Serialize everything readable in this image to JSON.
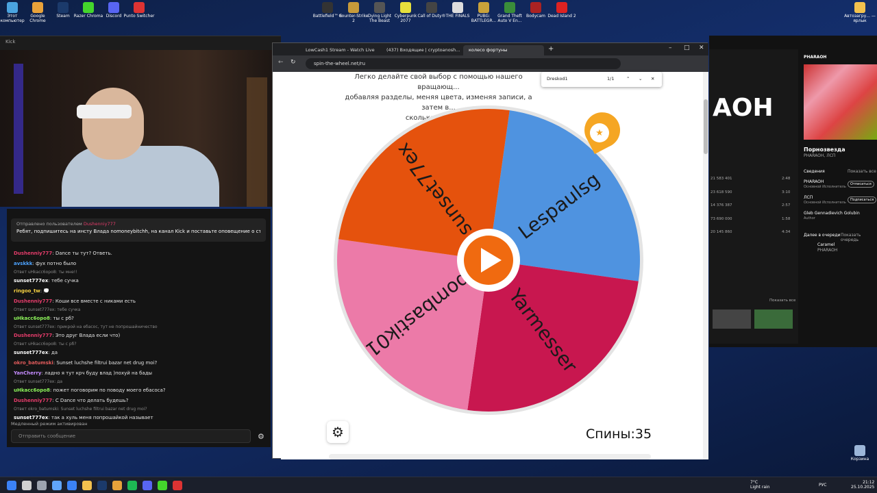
{
  "desktop": {
    "icons": [
      {
        "label": "Этот компьютер",
        "color": "#4aa3df"
      },
      {
        "label": "Google Chrome",
        "color": "#e8a23a"
      },
      {
        "label": "Steam",
        "color": "#1b3a6b"
      },
      {
        "label": "Razer Chroma",
        "color": "#44d62c"
      },
      {
        "label": "Discord",
        "color": "#5865f2"
      },
      {
        "label": "Punto Switcher",
        "color": "#d33"
      }
    ],
    "icons_mid": [
      {
        "label": "Battlefield™ 6",
        "color": "#333"
      },
      {
        "label": "Counter-Strike 2",
        "color": "#c79a3a"
      },
      {
        "label": "Dying Light The Beast",
        "color": "#555"
      },
      {
        "label": "Cyberpunk 2077",
        "color": "#e6e03c"
      },
      {
        "label": "Call of Duty®",
        "color": "#444"
      },
      {
        "label": "THE FINALS",
        "color": "#ddd"
      },
      {
        "label": "PUBG: BATTLEGR...",
        "color": "#c9a23a"
      },
      {
        "label": "Grand Theft Auto V En...",
        "color": "#3a8d3a"
      },
      {
        "label": "Bodycam",
        "color": "#a22"
      },
      {
        "label": "Dead Island 2",
        "color": "#d22"
      }
    ],
    "right_icon": "Автозагру... — ярлык",
    "recycle": "Корзина"
  },
  "webcam": {
    "title": "Kick"
  },
  "chat": {
    "pinned": {
      "by_label": "Отправлено пользователем",
      "author": "Dushenniy777",
      "text": "Ребят, подпишитесь на инсту Влада nomoneybitchh, на канал Kick и поставьте оповещение о стр..."
    },
    "messages": [
      {
        "user": "Dushenniy777",
        "color": "#e33c6a",
        "text": ": Dance ты тут? Ответь."
      },
      {
        "user": "avskkk",
        "color": "#4da3ff",
        "text": ": фух потно было"
      },
      {
        "reply": "Ответ uHkacc6opo8: ты мне!!"
      },
      {
        "user": "sunset777ex",
        "color": "#ffffff",
        "text": ": тебе сучка"
      },
      {
        "user": "ringoo_tw",
        "color": "#f5d142",
        "text": ": 💭"
      },
      {
        "user": "Dushenniy777",
        "color": "#e33c6a",
        "text": ": Коши все вместе с никами есть"
      },
      {
        "reply": "Ответ sunset777ex: тебе сучка"
      },
      {
        "user": "uHkacc6opo8",
        "color": "#8ef55b",
        "text": ": ты с рб?"
      },
      {
        "reply": "Ответ sunset777ex: прикрой на ебасос, тут не попрошайничество"
      },
      {
        "user": "Dushenniy777",
        "color": "#e33c6a",
        "text": ": Это друг Влада если что)"
      },
      {
        "reply": "Ответ uHkacc6opo8: ты с рб?"
      },
      {
        "user": "sunset777ex",
        "color": "#ffffff",
        "text": ": да"
      },
      {
        "user": "okro_batumski",
        "color": "#e35c5c",
        "text": ": Sunset luchshe filtrui bazar net drug moi?"
      },
      {
        "user": "YanCherry",
        "color": "#c58cff",
        "text": ": ладно я тут крч буду влад )похуй на бады"
      },
      {
        "reply": "Ответ sunset777ex: да"
      },
      {
        "user": "uHkacc6opo8",
        "color": "#8ef55b",
        "text": ": пожет поговорим по поводу моего ебасоса?"
      },
      {
        "user": "Dushenniy777",
        "color": "#e33c6a",
        "text": ": С Dance что делать будешь?"
      },
      {
        "reply": "Ответ okro_batumski: Sunset luchshe filtrui bazar net drug moi?"
      },
      {
        "user": "sunset777ex",
        "color": "#ffffff",
        "text": ": так а хуль меня попрошайкой называет"
      }
    ],
    "slow_mode": "Медленный режим активирован",
    "input_placeholder": "Отправить сообщение"
  },
  "spotify": {
    "banner": "АОН",
    "rows": [
      "21 583 401",
      "23 618 590",
      "14 376 387",
      "73 690 000",
      "20 145 860"
    ],
    "durations": [
      "2:48",
      "3:10",
      "2:57",
      "1:58",
      "4:34"
    ],
    "show_all": "Показать все",
    "np_artist": "PHARAOH",
    "np_title": "Порнозвезда",
    "np_subtitle": "PHARAOH, ЛСП",
    "credits": "Сведения",
    "credit_items": [
      {
        "name": "PHARAOH",
        "role": "Основной Исполнитель",
        "btn": "Отписаться"
      },
      {
        "name": "ЛСП",
        "role": "Основной Исполнитель",
        "btn": "Подписаться"
      },
      {
        "name": "Gleb Gennadievich Golubin",
        "role": "Author",
        "btn": ""
      }
    ],
    "queue": "Далее в очереди",
    "show_queue": "Показать очередь",
    "queue_track": "Caramel",
    "queue_artist": "PHARAOH"
  },
  "browser": {
    "tabs": [
      {
        "label": "LowCash1 Stream - Watch Live",
        "active": false
      },
      {
        "label": "(437) Входящие | cryptoanosh...",
        "active": false
      },
      {
        "label": "колесо фортуны",
        "active": true
      }
    ],
    "url": "spin-the-wheel.net/ru",
    "find_query": "Dreskod1",
    "find_count": "1/1"
  },
  "page": {
    "intro_line1": "Легко делайте свой выбор с помощью нашего вращающ...",
    "intro_line2": "добавляя разделы, меняя цвета, изменяя записи, а затем в...",
    "intro_line3": "сколько захотите.",
    "spins_label": "Спины",
    "spins_value": "35",
    "wheel_segments": [
      {
        "label": "Lespaulsg",
        "color": "#4f93e0"
      },
      {
        "label": "Yarmesser",
        "color": "#c8174f"
      },
      {
        "label": "bombastik01",
        "color": "#ec7aa8"
      },
      {
        "label": "sunset77ex",
        "color": "#e5520d"
      }
    ],
    "play_color": "#f06a10",
    "pointer_color": "#f5a623"
  },
  "taskbar": {
    "icons": [
      "#3b82f6",
      "#d0d0d0",
      "#9ca3af",
      "#60a5fa",
      "#3b82f6",
      "#f2c14e",
      "#1b3a6b",
      "#e8a23a",
      "#1db954",
      "#5865f2",
      "#44d62c",
      "#d33"
    ],
    "temp": "7°C",
    "weather": "Light rain",
    "lang": "РУС",
    "time": "21:12",
    "date": "25.10.2025"
  }
}
